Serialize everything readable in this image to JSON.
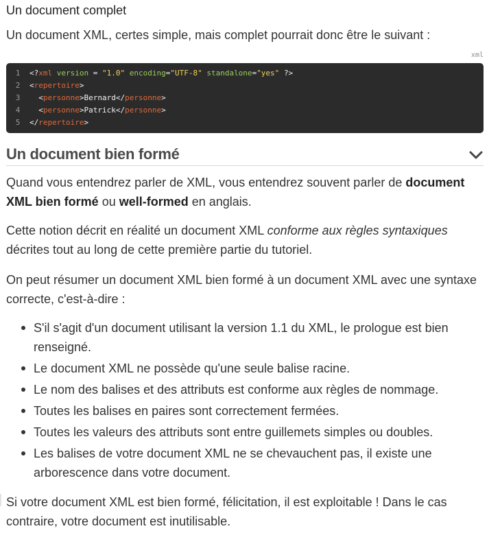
{
  "heading_small": "Un document complet",
  "intro": "Un document XML, certes simple, mais complet pourrait donc être le suivant :",
  "code_block": {
    "language": "xml",
    "lines": [
      {
        "num": "1",
        "tokens": [
          [
            "pun",
            "<?"
          ],
          [
            "kw",
            "xml"
          ],
          [
            "txt",
            " "
          ],
          [
            "attr",
            "version"
          ],
          [
            "txt",
            " = "
          ],
          [
            "str",
            "\"1.0\""
          ],
          [
            "txt",
            " "
          ],
          [
            "attr",
            "encoding"
          ],
          [
            "txt",
            "="
          ],
          [
            "str",
            "\"UTF-8\""
          ],
          [
            "txt",
            " "
          ],
          [
            "attr",
            "standalone"
          ],
          [
            "txt",
            "="
          ],
          [
            "str",
            "\"yes\""
          ],
          [
            "txt",
            " "
          ],
          [
            "pun",
            "?>"
          ]
        ]
      },
      {
        "num": "2",
        "tokens": [
          [
            "pun",
            "<"
          ],
          [
            "tag",
            "repertoire"
          ],
          [
            "pun",
            ">"
          ]
        ]
      },
      {
        "num": "3",
        "tokens": [
          [
            "txt",
            "  "
          ],
          [
            "pun",
            "<"
          ],
          [
            "tag",
            "personne"
          ],
          [
            "pun",
            ">"
          ],
          [
            "txt",
            "Bernard"
          ],
          [
            "pun",
            "</"
          ],
          [
            "tag",
            "personne"
          ],
          [
            "pun",
            ">"
          ]
        ]
      },
      {
        "num": "4",
        "tokens": [
          [
            "txt",
            "  "
          ],
          [
            "pun",
            "<"
          ],
          [
            "tag",
            "personne"
          ],
          [
            "pun",
            ">"
          ],
          [
            "txt",
            "Patrick"
          ],
          [
            "pun",
            "</"
          ],
          [
            "tag",
            "personne"
          ],
          [
            "pun",
            ">"
          ]
        ]
      },
      {
        "num": "5",
        "tokens": [
          [
            "pun",
            "</"
          ],
          [
            "tag",
            "repertoire"
          ],
          [
            "pun",
            ">"
          ]
        ]
      }
    ]
  },
  "section": {
    "title": "Un document bien formé",
    "paragraph1": {
      "before": "Quand vous entendrez parler de XML, vous entendrez souvent parler de ",
      "bold1": "document XML bien formé",
      "middle": " ou ",
      "bold2": "well-formed",
      "after": " en anglais."
    },
    "paragraph2": {
      "before": "Cette notion décrit en réalité un document XML ",
      "italic": "conforme aux règles syntaxiques",
      "after": " décrites tout au long de cette première partie du tutoriel."
    },
    "paragraph3": "On peut résumer un document XML bien formé à un document XML avec une syntaxe correcte, c'est-à-dire :",
    "rules": [
      "S'il s'agit d'un document utilisant la version 1.1 du XML, le prologue est bien renseigné.",
      "Le document XML ne possède qu'une seule balise racine.",
      "Le nom des balises et des attributs est conforme aux règles de nommage.",
      "Toutes les balises en paires sont correctement fermées.",
      "Toutes les valeurs des attributs sont entre guillemets simples ou doubles.",
      "Les balises de votre document XML ne se chevauchent pas, il existe une arborescence dans votre document."
    ],
    "paragraph4": "Si votre document XML est bien formé, félicitation, il est exploitable ! Dans le cas contraire, votre document est inutilisable."
  },
  "icons": {
    "collapse": "chevron-down-icon"
  }
}
